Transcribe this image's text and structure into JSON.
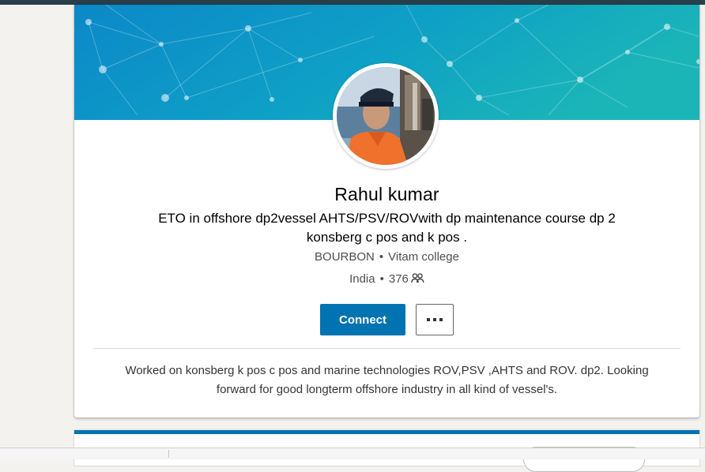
{
  "profile": {
    "name": "Rahul kumar",
    "headline": "ETO in offshore dp2vessel AHTS/PSV/ROVwith dp maintenance course dp 2 konsberg c pos and k pos .",
    "company": "BOURBON",
    "school": "Vitam college",
    "location": "India",
    "connections": "376",
    "separator": "•",
    "summary": "Worked on konsberg k pos c pos and marine technologies ROV,PSV ,AHTS and ROV. dp2. Looking forward for good longterm offshore industry in all kind of vessel's."
  },
  "actions": {
    "connect_label": "Connect",
    "more_icon": "ellipsis-icon"
  },
  "icons": {
    "connections": "people-icon",
    "close": "close-icon"
  },
  "colors": {
    "primary": "#0073b1",
    "banner_start": "#0b87c9",
    "banner_end": "#19b3b9",
    "topbar": "#283e4a"
  }
}
